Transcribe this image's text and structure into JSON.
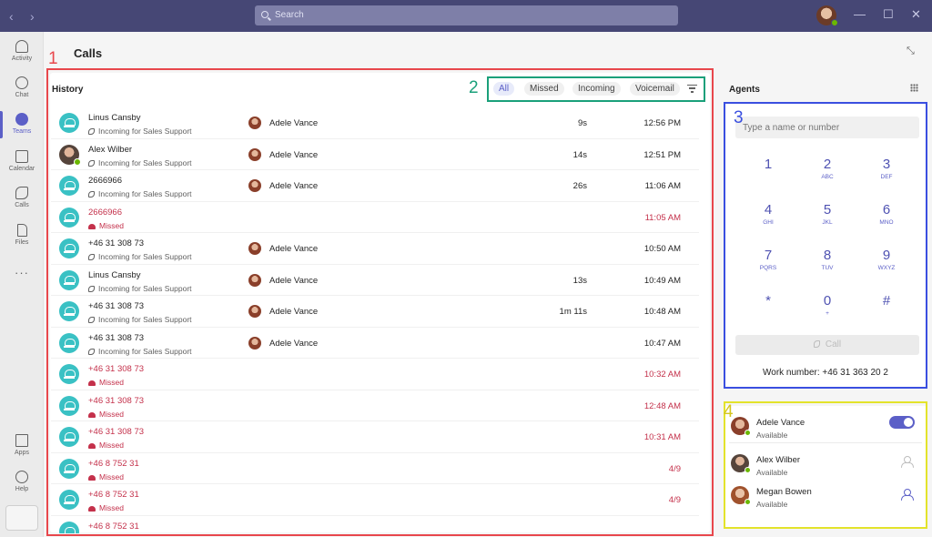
{
  "search": {
    "placeholder": "Search"
  },
  "window": {
    "minimize": "—",
    "maximize": "☐",
    "close": "✕"
  },
  "rail": [
    {
      "label": "Activity",
      "icon": "bell-icon"
    },
    {
      "label": "Chat",
      "icon": "chat-icon"
    },
    {
      "label": "Teams",
      "icon": "teams-icon",
      "active": true
    },
    {
      "label": "Calendar",
      "icon": "calendar-icon"
    },
    {
      "label": "Calls",
      "icon": "calls-icon"
    },
    {
      "label": "Files",
      "icon": "files-icon"
    }
  ],
  "rail_more": "···",
  "rail_bottom": [
    {
      "label": "Apps",
      "icon": "apps-icon"
    },
    {
      "label": "Help",
      "icon": "help-icon"
    }
  ],
  "page": {
    "title": "Calls"
  },
  "history": {
    "title": "History",
    "filters": [
      "All",
      "Missed",
      "Incoming",
      "Voicemail"
    ],
    "active_filter": "All",
    "rows": [
      {
        "name": "Linus Cansby",
        "sub": "Incoming for Sales Support",
        "agent": "Adele Vance",
        "duration": "9s",
        "time": "12:56 PM",
        "missed": false,
        "photo": false
      },
      {
        "name": "Alex Wilber",
        "sub": "Incoming for Sales Support",
        "agent": "Adele Vance",
        "duration": "14s",
        "time": "12:51 PM",
        "missed": false,
        "photo": true
      },
      {
        "name": "2666966",
        "sub": "Incoming for Sales Support",
        "agent": "Adele Vance",
        "duration": "26s",
        "time": "11:06 AM",
        "missed": false,
        "photo": false
      },
      {
        "name": "2666966",
        "sub": "Missed",
        "agent": "",
        "duration": "",
        "time": "11:05 AM",
        "missed": true,
        "photo": false
      },
      {
        "name": "+46 31 308 73",
        "sub": "Incoming for Sales Support",
        "agent": "Adele Vance",
        "duration": "",
        "time": "10:50 AM",
        "missed": false,
        "photo": false
      },
      {
        "name": "Linus Cansby",
        "sub": "Incoming for Sales Support",
        "agent": "Adele Vance",
        "duration": "13s",
        "time": "10:49 AM",
        "missed": false,
        "photo": false
      },
      {
        "name": "+46 31 308 73",
        "sub": "Incoming for Sales Support",
        "agent": "Adele Vance",
        "duration": "1m 11s",
        "time": "10:48 AM",
        "missed": false,
        "photo": false
      },
      {
        "name": "+46 31 308 73",
        "sub": "Incoming for Sales Support",
        "agent": "Adele Vance",
        "duration": "",
        "time": "10:47 AM",
        "missed": false,
        "photo": false
      },
      {
        "name": "+46 31 308 73",
        "sub": "Missed",
        "agent": "",
        "duration": "",
        "time": "10:32 AM",
        "missed": true,
        "photo": false
      },
      {
        "name": "+46 31 308 73",
        "sub": "Missed",
        "agent": "",
        "duration": "",
        "time": "12:48 AM",
        "missed": true,
        "photo": false
      },
      {
        "name": "+46 31 308 73",
        "sub": "Missed",
        "agent": "",
        "duration": "",
        "time": "10:31 AM",
        "missed": true,
        "photo": false
      },
      {
        "name": "+46 8 752 31",
        "sub": "Missed",
        "agent": "",
        "duration": "",
        "time": "4/9",
        "missed": true,
        "photo": false
      },
      {
        "name": "+46 8 752 31",
        "sub": "Missed",
        "agent": "",
        "duration": "",
        "time": "4/9",
        "missed": true,
        "photo": false
      },
      {
        "name": "+46 8 752 31",
        "sub": "",
        "agent": "",
        "duration": "",
        "time": "",
        "missed": true,
        "photo": false
      }
    ]
  },
  "dialpad": {
    "title": "Agents",
    "placeholder": "Type a name or number",
    "keys": [
      {
        "digit": "1",
        "letters": ""
      },
      {
        "digit": "2",
        "letters": "ABC"
      },
      {
        "digit": "3",
        "letters": "DEF"
      },
      {
        "digit": "4",
        "letters": "GHI"
      },
      {
        "digit": "5",
        "letters": "JKL"
      },
      {
        "digit": "6",
        "letters": "MNO"
      },
      {
        "digit": "7",
        "letters": "PQRS"
      },
      {
        "digit": "8",
        "letters": "TUV"
      },
      {
        "digit": "9",
        "letters": "WXYZ"
      },
      {
        "digit": "*",
        "letters": ""
      },
      {
        "digit": "0",
        "letters": "+"
      },
      {
        "digit": "#",
        "letters": ""
      }
    ],
    "call_label": "Call",
    "work_number": "Work number: +46 31 363 20 2"
  },
  "agents": [
    {
      "name": "Adele Vance",
      "status": "Available",
      "control": "toggle-on"
    },
    {
      "name": "Alex Wilber",
      "status": "Available",
      "control": "person-icon"
    },
    {
      "name": "Megan Bowen",
      "status": "Available",
      "control": "person-icon"
    }
  ],
  "annotations": [
    "1",
    "2",
    "3",
    "4"
  ],
  "colors": {
    "titlebar": "#464775",
    "accent": "#5b5fc7",
    "missed": "#c4314b",
    "avatar_teal": "#3ac1c4",
    "presence": "#6bb700",
    "box1": "#e8474c",
    "box2": "#1aa07a",
    "box3": "#3a4fe0",
    "box4": "#e3e32b"
  }
}
